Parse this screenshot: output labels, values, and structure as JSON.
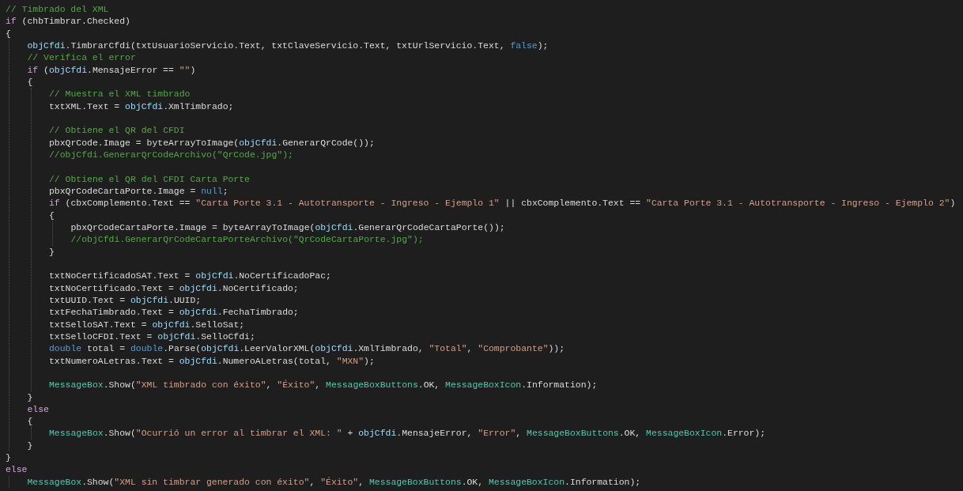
{
  "editor": {
    "lines": [
      {
        "kind": "code",
        "tokens": [
          {
            "text": "// Timbrado del XML",
            "kind": "comment"
          }
        ]
      },
      {
        "kind": "code",
        "tokens": [
          {
            "text": "if",
            "kind": "control"
          },
          {
            "text": " (chbTimbrar.Checked)",
            "kind": "plain"
          }
        ]
      },
      {
        "kind": "code",
        "tokens": [
          {
            "text": "{",
            "kind": "plain"
          }
        ],
        "children": [
          {
            "kind": "code",
            "tokens": [
              {
                "text": "objCfdi",
                "kind": "field"
              },
              {
                "text": ".TimbrarCfdi(txtUsuarioServicio.Text, txtClaveServicio.Text, txtUrlServicio.Text, ",
                "kind": "plain"
              },
              {
                "text": "false",
                "kind": "keyword"
              },
              {
                "text": ");",
                "kind": "plain"
              }
            ]
          },
          {
            "kind": "code",
            "tokens": [
              {
                "text": "// Verifica el error",
                "kind": "comment"
              }
            ]
          },
          {
            "kind": "code",
            "tokens": [
              {
                "text": "if",
                "kind": "control"
              },
              {
                "text": " (",
                "kind": "plain"
              },
              {
                "text": "objCfdi",
                "kind": "field"
              },
              {
                "text": ".MensajeError == ",
                "kind": "plain"
              },
              {
                "text": "\"\"",
                "kind": "string"
              },
              {
                "text": ")",
                "kind": "plain"
              }
            ]
          },
          {
            "kind": "code",
            "tokens": [
              {
                "text": "{",
                "kind": "plain"
              }
            ],
            "children": [
              {
                "kind": "code",
                "tokens": [
                  {
                    "text": "// Muestra el XML timbrado",
                    "kind": "comment"
                  }
                ]
              },
              {
                "kind": "code",
                "tokens": [
                  {
                    "text": "txtXML.Text = ",
                    "kind": "plain"
                  },
                  {
                    "text": "objCfdi",
                    "kind": "field"
                  },
                  {
                    "text": ".XmlTimbrado;",
                    "kind": "plain"
                  }
                ]
              },
              {
                "kind": "blank"
              },
              {
                "kind": "code",
                "tokens": [
                  {
                    "text": "// Obtiene el QR del CFDI",
                    "kind": "comment"
                  }
                ]
              },
              {
                "kind": "code",
                "tokens": [
                  {
                    "text": "pbxQrCode.Image = byteArrayToImage(",
                    "kind": "plain"
                  },
                  {
                    "text": "objCfdi",
                    "kind": "field"
                  },
                  {
                    "text": ".GenerarQrCode());",
                    "kind": "plain"
                  }
                ]
              },
              {
                "kind": "code",
                "tokens": [
                  {
                    "text": "//objCfdi.GenerarQrCodeArchivo(\"QrCode.jpg\");",
                    "kind": "comment"
                  }
                ]
              },
              {
                "kind": "blank"
              },
              {
                "kind": "code",
                "tokens": [
                  {
                    "text": "// Obtiene el QR del CFDI Carta Porte",
                    "kind": "comment"
                  }
                ]
              },
              {
                "kind": "code",
                "tokens": [
                  {
                    "text": "pbxQrCodeCartaPorte.Image = ",
                    "kind": "plain"
                  },
                  {
                    "text": "null",
                    "kind": "keyword"
                  },
                  {
                    "text": ";",
                    "kind": "plain"
                  }
                ]
              },
              {
                "kind": "code",
                "tokens": [
                  {
                    "text": "if",
                    "kind": "control"
                  },
                  {
                    "text": " (cbxComplemento.Text == ",
                    "kind": "plain"
                  },
                  {
                    "text": "\"Carta Porte 3.1 - Autotransporte - Ingreso - Ejemplo 1\"",
                    "kind": "string"
                  },
                  {
                    "text": " || cbxComplemento.Text == ",
                    "kind": "plain"
                  },
                  {
                    "text": "\"Carta Porte 3.1 - Autotransporte - Ingreso - Ejemplo 2\"",
                    "kind": "string"
                  },
                  {
                    "text": ")",
                    "kind": "plain"
                  }
                ]
              },
              {
                "kind": "code",
                "tokens": [
                  {
                    "text": "{",
                    "kind": "plain"
                  }
                ],
                "children": [
                  {
                    "kind": "code",
                    "tokens": [
                      {
                        "text": "pbxQrCodeCartaPorte.Image = byteArrayToImage(",
                        "kind": "plain"
                      },
                      {
                        "text": "objCfdi",
                        "kind": "field"
                      },
                      {
                        "text": ".GenerarQrCodeCartaPorte());",
                        "kind": "plain"
                      }
                    ]
                  },
                  {
                    "kind": "code",
                    "tokens": [
                      {
                        "text": "//objCfdi.GenerarQrCodeCartaPorteArchivo(\"QrCodeCartaPorte.jpg\");",
                        "kind": "comment"
                      }
                    ]
                  }
                ]
              },
              {
                "kind": "code",
                "tokens": [
                  {
                    "text": "}",
                    "kind": "plain"
                  }
                ]
              },
              {
                "kind": "blank"
              },
              {
                "kind": "code",
                "tokens": [
                  {
                    "text": "txtNoCertificadoSAT.Text = ",
                    "kind": "plain"
                  },
                  {
                    "text": "objCfdi",
                    "kind": "field"
                  },
                  {
                    "text": ".NoCertificadoPac;",
                    "kind": "plain"
                  }
                ]
              },
              {
                "kind": "code",
                "tokens": [
                  {
                    "text": "txtNoCertificado.Text = ",
                    "kind": "plain"
                  },
                  {
                    "text": "objCfdi",
                    "kind": "field"
                  },
                  {
                    "text": ".NoCertificado;",
                    "kind": "plain"
                  }
                ]
              },
              {
                "kind": "code",
                "tokens": [
                  {
                    "text": "txtUUID.Text = ",
                    "kind": "plain"
                  },
                  {
                    "text": "objCfdi",
                    "kind": "field"
                  },
                  {
                    "text": ".UUID;",
                    "kind": "plain"
                  }
                ]
              },
              {
                "kind": "code",
                "tokens": [
                  {
                    "text": "txtFechaTimbrado.Text = ",
                    "kind": "plain"
                  },
                  {
                    "text": "objCfdi",
                    "kind": "field"
                  },
                  {
                    "text": ".FechaTimbrado;",
                    "kind": "plain"
                  }
                ]
              },
              {
                "kind": "code",
                "tokens": [
                  {
                    "text": "txtSelloSAT.Text = ",
                    "kind": "plain"
                  },
                  {
                    "text": "objCfdi",
                    "kind": "field"
                  },
                  {
                    "text": ".SelloSat;",
                    "kind": "plain"
                  }
                ]
              },
              {
                "kind": "code",
                "tokens": [
                  {
                    "text": "txtSelloCFDI.Text = ",
                    "kind": "plain"
                  },
                  {
                    "text": "objCfdi",
                    "kind": "field"
                  },
                  {
                    "text": ".SelloCfdi;",
                    "kind": "plain"
                  }
                ]
              },
              {
                "kind": "code",
                "tokens": [
                  {
                    "text": "double",
                    "kind": "keyword"
                  },
                  {
                    "text": " total = ",
                    "kind": "plain"
                  },
                  {
                    "text": "double",
                    "kind": "keyword"
                  },
                  {
                    "text": ".Parse(",
                    "kind": "plain"
                  },
                  {
                    "text": "objCfdi",
                    "kind": "field"
                  },
                  {
                    "text": ".LeerValorXML(",
                    "kind": "plain"
                  },
                  {
                    "text": "objCfdi",
                    "kind": "field"
                  },
                  {
                    "text": ".XmlTimbrado, ",
                    "kind": "plain"
                  },
                  {
                    "text": "\"Total\"",
                    "kind": "string"
                  },
                  {
                    "text": ", ",
                    "kind": "plain"
                  },
                  {
                    "text": "\"Comprobante\"",
                    "kind": "string"
                  },
                  {
                    "text": "));",
                    "kind": "plain"
                  }
                ]
              },
              {
                "kind": "code",
                "tokens": [
                  {
                    "text": "txtNumeroALetras.Text = ",
                    "kind": "plain"
                  },
                  {
                    "text": "objCfdi",
                    "kind": "field"
                  },
                  {
                    "text": ".NumeroALetras(total, ",
                    "kind": "plain"
                  },
                  {
                    "text": "\"MXN\"",
                    "kind": "string"
                  },
                  {
                    "text": ");",
                    "kind": "plain"
                  }
                ]
              },
              {
                "kind": "blank"
              },
              {
                "kind": "code",
                "tokens": [
                  {
                    "text": "MessageBox",
                    "kind": "type"
                  },
                  {
                    "text": ".Show(",
                    "kind": "plain"
                  },
                  {
                    "text": "\"XML timbrado con éxito\"",
                    "kind": "string"
                  },
                  {
                    "text": ", ",
                    "kind": "plain"
                  },
                  {
                    "text": "\"Éxito\"",
                    "kind": "string"
                  },
                  {
                    "text": ", ",
                    "kind": "plain"
                  },
                  {
                    "text": "MessageBoxButtons",
                    "kind": "type"
                  },
                  {
                    "text": ".OK, ",
                    "kind": "plain"
                  },
                  {
                    "text": "MessageBoxIcon",
                    "kind": "type"
                  },
                  {
                    "text": ".Information);",
                    "kind": "plain"
                  }
                ]
              }
            ]
          },
          {
            "kind": "code",
            "tokens": [
              {
                "text": "}",
                "kind": "plain"
              }
            ]
          },
          {
            "kind": "code",
            "tokens": [
              {
                "text": "else",
                "kind": "control"
              }
            ]
          },
          {
            "kind": "code",
            "tokens": [
              {
                "text": "{",
                "kind": "plain"
              }
            ],
            "children": [
              {
                "kind": "code",
                "tokens": [
                  {
                    "text": "MessageBox",
                    "kind": "type"
                  },
                  {
                    "text": ".Show(",
                    "kind": "plain"
                  },
                  {
                    "text": "\"Ocurrió un error al timbrar el XML: \"",
                    "kind": "string"
                  },
                  {
                    "text": " + ",
                    "kind": "plain"
                  },
                  {
                    "text": "objCfdi",
                    "kind": "field"
                  },
                  {
                    "text": ".MensajeError, ",
                    "kind": "plain"
                  },
                  {
                    "text": "\"Error\"",
                    "kind": "string"
                  },
                  {
                    "text": ", ",
                    "kind": "plain"
                  },
                  {
                    "text": "MessageBoxButtons",
                    "kind": "type"
                  },
                  {
                    "text": ".OK, ",
                    "kind": "plain"
                  },
                  {
                    "text": "MessageBoxIcon",
                    "kind": "type"
                  },
                  {
                    "text": ".Error);",
                    "kind": "plain"
                  }
                ]
              }
            ]
          },
          {
            "kind": "code",
            "tokens": [
              {
                "text": "}",
                "kind": "plain"
              }
            ]
          }
        ]
      },
      {
        "kind": "code",
        "tokens": [
          {
            "text": "}",
            "kind": "plain"
          }
        ]
      },
      {
        "kind": "code",
        "tokens": [
          {
            "text": "else",
            "kind": "control"
          }
        ],
        "children": [
          {
            "kind": "code",
            "tokens": [
              {
                "text": "MessageBox",
                "kind": "type"
              },
              {
                "text": ".Show(",
                "kind": "plain"
              },
              {
                "text": "\"XML sin timbrar generado con éxito\"",
                "kind": "string"
              },
              {
                "text": ", ",
                "kind": "plain"
              },
              {
                "text": "\"Éxito\"",
                "kind": "string"
              },
              {
                "text": ", ",
                "kind": "plain"
              },
              {
                "text": "MessageBoxButtons",
                "kind": "type"
              },
              {
                "text": ".OK, ",
                "kind": "plain"
              },
              {
                "text": "MessageBoxIcon",
                "kind": "type"
              },
              {
                "text": ".Information);",
                "kind": "plain"
              }
            ]
          }
        ]
      }
    ]
  }
}
